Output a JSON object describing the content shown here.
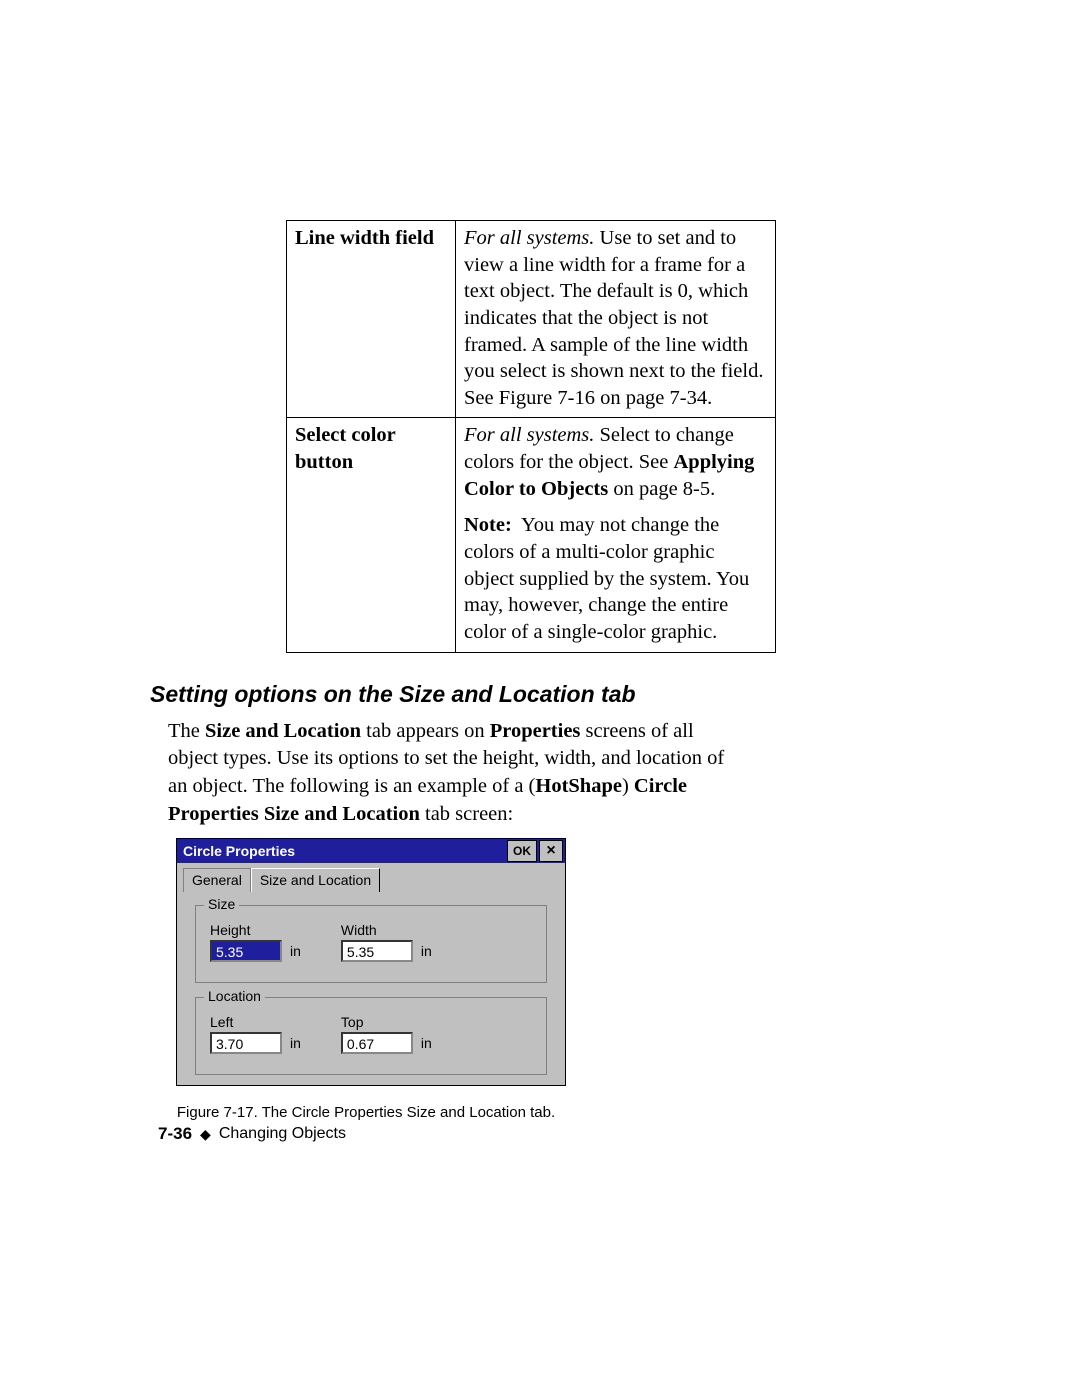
{
  "table": {
    "row1": {
      "label": "Line width field",
      "italic_lead": "For all systems.",
      "desc": " Use to set and to view a line width for a frame for a text object. The default is 0, which indicates that the object is not framed. A sample of the line width you select is shown next to the field. See Figure 7-16 on page 7-34."
    },
    "row2": {
      "label": "Select color button",
      "italic_lead": "For all systems.",
      "desc1": " Select to change colors for the object. See ",
      "bold_ref": "Applying Color to Objects",
      "desc2": " on page 8-5.",
      "note_label": "Note:",
      "note_text": "You may not change the colors of a multi-color graphic object supplied by the system. You may, however, change the entire color of a single-color graphic."
    }
  },
  "heading": "Setting options on the Size and Location tab",
  "para": {
    "t1": "The ",
    "b1": "Size and Location",
    "t2": " tab appears on ",
    "b2": "Properties",
    "t3": " screens of all object types. Use its options to set the height, width, and location of an object. The following is an example of a (",
    "b3": "HotShape",
    "t4": ") ",
    "b4": "Circle Properties Size and Location",
    "t5": " tab screen:"
  },
  "dialog": {
    "title": "Circle Properties",
    "ok": "OK",
    "close": "×",
    "tabs": {
      "general": "General",
      "size_loc": "Size and Location"
    },
    "size": {
      "legend": "Size",
      "height_label": "Height",
      "height_value": "5.35",
      "width_label": "Width",
      "width_value": "5.35",
      "unit": "in"
    },
    "location": {
      "legend": "Location",
      "left_label": "Left",
      "left_value": "3.70",
      "top_label": "Top",
      "top_value": "0.67",
      "unit": "in"
    }
  },
  "figure_caption": "Figure 7-17. The Circle Properties Size and Location tab.",
  "footer": {
    "page": "7-36",
    "diamond": "◆",
    "chapter": "Changing Objects"
  }
}
